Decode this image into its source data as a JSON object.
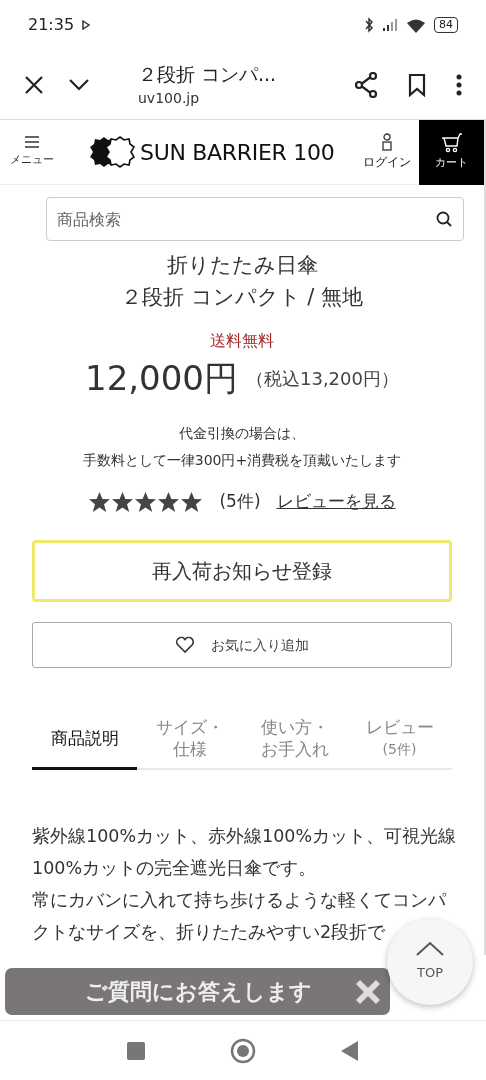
{
  "status_bar": {
    "time": "21:35",
    "battery": "84"
  },
  "browser": {
    "title": "２段折 コンパ...",
    "url": "uv100.jp"
  },
  "site_header": {
    "menu_label": "メニュー",
    "logo": "SUN BARRIER 100",
    "login_label": "ログイン",
    "cart_label": "カート"
  },
  "search": {
    "placeholder": "商品検索"
  },
  "product": {
    "title_lines": [
      "折りたたみ日傘",
      "２段折 コンパクト / 無地"
    ],
    "shipping": "送料無料",
    "price": "12,000円",
    "price_tax": "（税込13,200円）",
    "notes": [
      "代金引換の場合は、",
      "手数料として一律300円+消費税を頂戴いたします"
    ],
    "stars": 5,
    "review_count": "(5件)",
    "review_link": "レビューを見る"
  },
  "buttons": {
    "restock": "再入荷お知らせ登録",
    "favorite": "お気に入り追加"
  },
  "tabs": [
    {
      "lines": [
        "商品説明"
      ],
      "selected": true
    },
    {
      "lines": [
        "サイズ・",
        "仕様"
      ],
      "selected": false
    },
    {
      "lines": [
        "使い方・",
        "お手入れ"
      ],
      "selected": false
    },
    {
      "lines": [
        "レビュー",
        "(5件)"
      ],
      "selected": false
    }
  ],
  "description": [
    "紫外線100%カット、赤外線100%カット、可視光線",
    "100%カットの完全遮光日傘です。",
    "常にカバンに入れて持ち歩けるような軽くてコンパ",
    "クトなサイズを、折りたたみやすい2段折で"
  ],
  "question_banner": {
    "text": "ご質問にお答えします"
  },
  "top_button": {
    "label": "TOP"
  }
}
